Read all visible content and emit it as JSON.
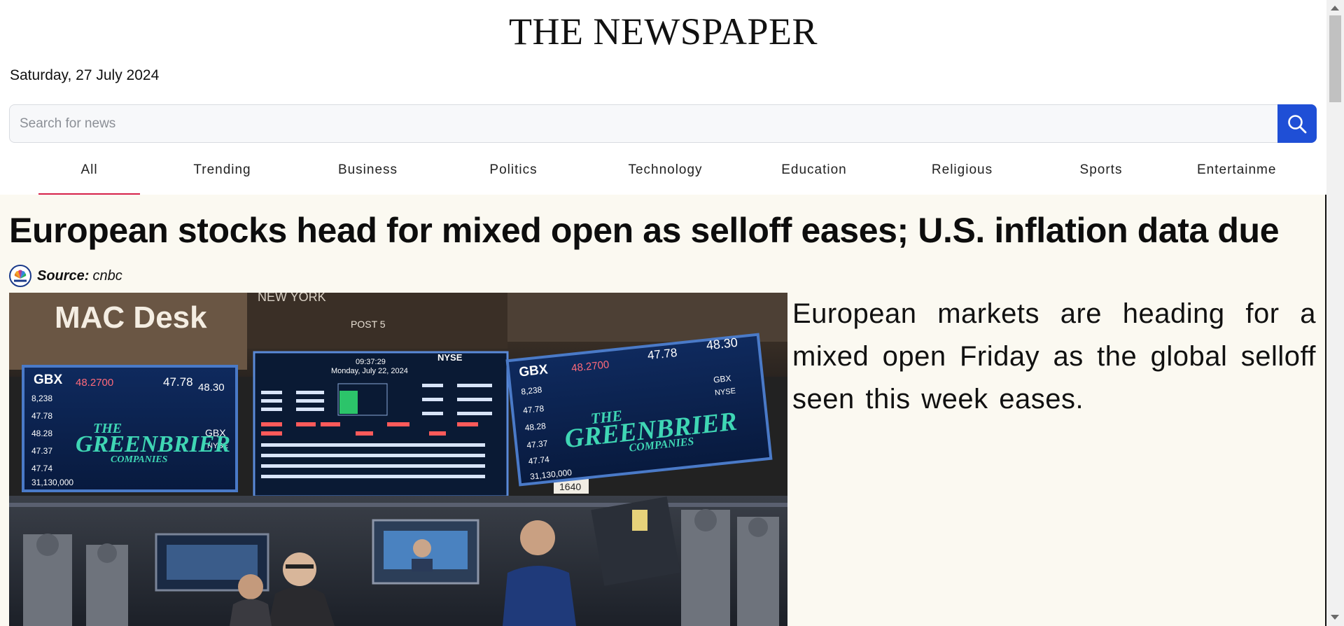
{
  "masthead": "THE NEWSPAPER",
  "date": "Saturday, 27 July 2024",
  "search": {
    "placeholder": "Search for news",
    "button_icon": "search-icon"
  },
  "tabs": [
    {
      "label": "All",
      "active": true
    },
    {
      "label": "Trending",
      "active": false
    },
    {
      "label": "Business",
      "active": false
    },
    {
      "label": "Politics",
      "active": false
    },
    {
      "label": "Technology",
      "active": false
    },
    {
      "label": "Education",
      "active": false
    },
    {
      "label": "Religious",
      "active": false
    },
    {
      "label": "Sports",
      "active": false
    },
    {
      "label": "Entertainme",
      "active": false
    }
  ],
  "article": {
    "headline": "European stocks head for mixed open as selloff eases; U.S. inflation data due",
    "source_label": "Source:",
    "source_name": "cnbc",
    "source_logo": "cnbc-peacock-logo",
    "summary": "European markets are heading for a mixed open Friday as the global selloff seen this week eases.",
    "image": {
      "description_icon": "stock-exchange-photo",
      "signage": {
        "desk": "MAC Desk",
        "ticker": "GBX",
        "price": "48.2700",
        "company_line1": "THE",
        "company_line2": "GREENBRIER",
        "company_line3": "COMPANIES",
        "exchange": "NYSE",
        "post": "POST 5",
        "booth": "1640",
        "street": "NEW YORK",
        "time": "09:37:29",
        "board_date": "Monday, July 22, 2024",
        "right_price": "48.30",
        "right_price2": "47.78"
      }
    }
  },
  "colors": {
    "accent_tab_underline": "#d6214a",
    "search_button": "#1f4fd6",
    "article_background": "#fbf9f1"
  }
}
